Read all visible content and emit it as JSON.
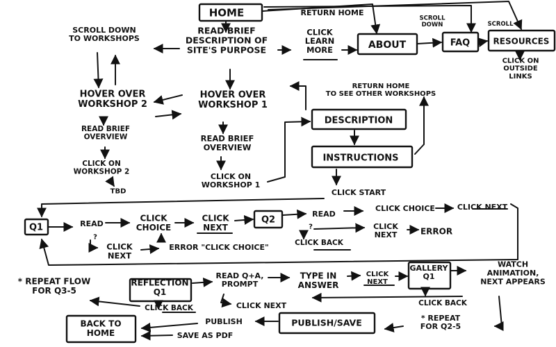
{
  "nodes": {
    "home": {
      "lines": [
        "HOME"
      ],
      "boxed": true
    },
    "return_home": {
      "lines": [
        "RETURN HOME"
      ]
    },
    "scroll_down_workshops": {
      "lines": [
        "SCROLL DOWN",
        "TO WORKSHOPS"
      ]
    },
    "read_brief_description": {
      "lines": [
        "READ BRIEF",
        "DESCRIPTION OF",
        "SITE'S PURPOSE"
      ]
    },
    "click_learn_more": {
      "lines": [
        "CLICK",
        "LEARN",
        "MORE"
      ]
    },
    "about": {
      "lines": [
        "ABOUT"
      ],
      "boxed": true
    },
    "scroll_down_faq": {
      "lines": [
        "SCROLL",
        "DOWN"
      ]
    },
    "faq": {
      "lines": [
        "FAQ"
      ],
      "boxed": true
    },
    "scroll_resources": {
      "lines": [
        "SCROLL"
      ]
    },
    "resources": {
      "lines": [
        "RESOURCES"
      ],
      "boxed": true
    },
    "click_outside_links": {
      "lines": [
        "CLICK ON",
        "OUTSIDE",
        "LINKS"
      ]
    },
    "hover_workshop_2": {
      "lines": [
        "HOVER OVER",
        "WORKSHOP 2"
      ]
    },
    "hover_workshop_1": {
      "lines": [
        "HOVER OVER",
        "WORKSHOP 1"
      ]
    },
    "return_home_other": {
      "lines": [
        "RETURN HOME",
        "TO SEE OTHER WORKSHOPS"
      ]
    },
    "read_brief_overview_2": {
      "lines": [
        "READ BRIEF",
        "OVERVIEW"
      ]
    },
    "read_brief_overview_1": {
      "lines": [
        "READ BRIEF",
        "OVERVIEW"
      ]
    },
    "description": {
      "lines": [
        "DESCRIPTION"
      ],
      "boxed": true
    },
    "instructions": {
      "lines": [
        "INSTRUCTIONS"
      ],
      "boxed": true
    },
    "click_workshop_2": {
      "lines": [
        "CLICK ON",
        "WORKSHOP 2"
      ]
    },
    "tbd": {
      "lines": [
        "TBD"
      ]
    },
    "click_workshop_1": {
      "lines": [
        "CLICK ON",
        "WORKSHOP 1"
      ]
    },
    "click_start": {
      "lines": [
        "CLICK START"
      ]
    },
    "q1": {
      "lines": [
        "Q1"
      ],
      "boxed": true
    },
    "read_q1": {
      "lines": [
        "READ"
      ]
    },
    "q_mark_1": {
      "lines": [
        "?"
      ]
    },
    "click_choice_1": {
      "lines": [
        "CLICK",
        "CHOICE"
      ]
    },
    "click_next_1": {
      "lines": [
        "CLICK",
        "NEXT"
      ]
    },
    "q2": {
      "lines": [
        "Q2"
      ],
      "boxed": true
    },
    "read_q2": {
      "lines": [
        "READ"
      ]
    },
    "q_mark_2": {
      "lines": [
        "?"
      ]
    },
    "click_choice_2": {
      "lines": [
        "CLICK CHOICE"
      ]
    },
    "click_next_2": {
      "lines": [
        "CLICK NEXT"
      ]
    },
    "click_next_error_2": {
      "lines": [
        "CLICK",
        "NEXT"
      ]
    },
    "error_2": {
      "lines": [
        "ERROR"
      ]
    },
    "click_next_wrong_1": {
      "lines": [
        "CLICK",
        "NEXT"
      ]
    },
    "error_click_choice": {
      "lines": [
        "ERROR \"CLICK CHOICE\""
      ]
    },
    "click_back_q2": {
      "lines": [
        "CLICK BACK"
      ]
    },
    "repeat_flow": {
      "lines": [
        "* REPEAT FLOW",
        "FOR Q3-5"
      ]
    },
    "reflection_q1": {
      "lines": [
        "REFLECTION",
        "Q1"
      ],
      "boxed": true
    },
    "read_qa_prompt": {
      "lines": [
        "READ Q+A,",
        "PROMPT"
      ]
    },
    "type_in_answer": {
      "lines": [
        "TYPE IN",
        "ANSWER"
      ]
    },
    "click_next_reflection": {
      "lines": [
        "CLICK",
        "NEXT"
      ]
    },
    "gallery_q1": {
      "lines": [
        "GALLERY",
        "Q1"
      ],
      "boxed": true
    },
    "watch_animation": {
      "lines": [
        "WATCH",
        "ANIMATION,",
        "NEXT APPEARS"
      ]
    },
    "click_back_reflection": {
      "lines": [
        "CLICK BACK"
      ]
    },
    "click_next_bottom": {
      "lines": [
        "CLICK NEXT"
      ]
    },
    "click_back_gallery": {
      "lines": [
        "CLICK BACK"
      ]
    },
    "repeat_q2_5": {
      "lines": [
        "* REPEAT",
        "FOR Q2-5"
      ]
    },
    "back_to_home": {
      "lines": [
        "BACK TO",
        "HOME"
      ],
      "boxed": true
    },
    "publish": {
      "lines": [
        "PUBLISH"
      ]
    },
    "publish_save": {
      "lines": [
        "PUBLISH/SAVE"
      ],
      "boxed": true
    },
    "save_as_pdf": {
      "lines": [
        "SAVE AS PDF"
      ]
    }
  }
}
